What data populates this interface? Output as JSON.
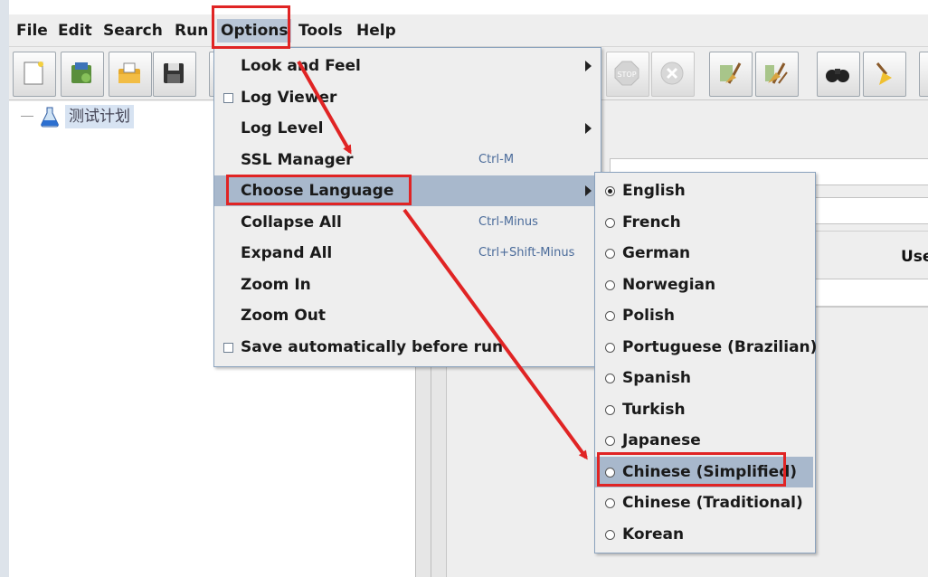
{
  "menubar": {
    "items": [
      "File",
      "Edit",
      "Search",
      "Run",
      "Options",
      "Tools",
      "Help"
    ],
    "open": "Options"
  },
  "tree": {
    "root_label": "测试计划"
  },
  "right_panel": {
    "user_label": "Use"
  },
  "options_menu": {
    "items": [
      {
        "label": "Look and Feel",
        "accel": "",
        "submenu": true,
        "check": false
      },
      {
        "label": "Log Viewer",
        "accel": "",
        "submenu": false,
        "check": true
      },
      {
        "label": "Log Level",
        "accel": "",
        "submenu": true,
        "check": false
      },
      {
        "label": "SSL Manager",
        "accel": "Ctrl-M",
        "submenu": false,
        "check": false
      },
      {
        "label": "Choose Language",
        "accel": "",
        "submenu": true,
        "check": false
      },
      {
        "label": "Collapse All",
        "accel": "Ctrl-Minus",
        "submenu": false,
        "check": false
      },
      {
        "label": "Expand All",
        "accel": "Ctrl+Shift-Minus",
        "submenu": false,
        "check": false
      },
      {
        "label": "Zoom In",
        "accel": "",
        "submenu": false,
        "check": false
      },
      {
        "label": "Zoom Out",
        "accel": "",
        "submenu": false,
        "check": false
      },
      {
        "label": "Save automatically before run",
        "accel": "",
        "submenu": false,
        "check": true
      }
    ],
    "highlighted": "Choose Language"
  },
  "language_menu": {
    "items": [
      "English",
      "French",
      "German",
      "Norwegian",
      "Polish",
      "Portuguese (Brazilian)",
      "Spanish",
      "Turkish",
      "Japanese",
      "Chinese (Simplified)",
      "Chinese (Traditional)",
      "Korean"
    ],
    "selected": "English",
    "highlighted": "Chinese (Simplified)"
  },
  "colors": {
    "annotation": "#e02424",
    "highlight": "#a8b8cc",
    "accel_text": "#4a6b9a"
  }
}
